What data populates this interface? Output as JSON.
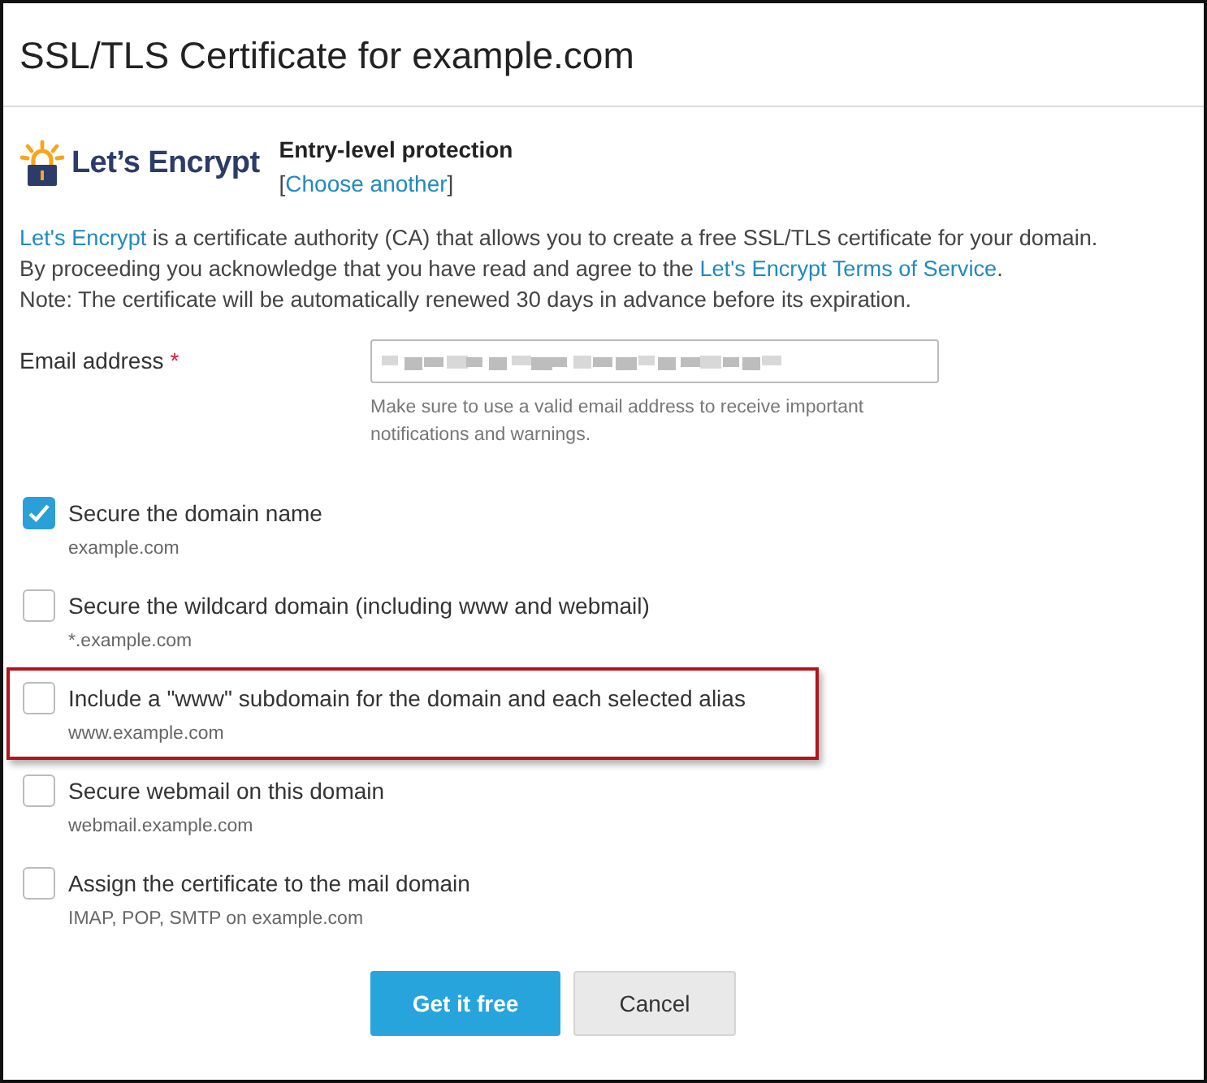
{
  "title": "SSL/TLS Certificate for example.com",
  "provider": {
    "logo_text": "Let’s Encrypt",
    "name": "Entry-level protection",
    "bracket_open": "[",
    "link": "Choose another",
    "bracket_close": "]"
  },
  "paragraph": [
    [
      {
        "kind": "link",
        "text": "Let's Encrypt"
      },
      {
        "kind": "text",
        "text": " is a certificate authority (CA) that allows you to create a free SSL/TLS certificate for your domain."
      }
    ],
    [
      {
        "kind": "text",
        "text": "By proceeding you acknowledge that you have read and agree to the "
      },
      {
        "kind": "link",
        "text": "Let's Encrypt Terms of Service"
      },
      {
        "kind": "text",
        "text": "."
      }
    ],
    [
      {
        "kind": "text",
        "text": "Note: The certificate will be automatically renewed 30 days in advance before its expiration."
      }
    ]
  ],
  "email": {
    "label": "Email address",
    "required_mark": "*",
    "hint": "Make sure to use a valid email address to receive important notifications and warnings."
  },
  "options": [
    {
      "label": "Secure the domain name",
      "sublabel": "example.com",
      "checked": true,
      "highlighted": false
    },
    {
      "label": "Secure the wildcard domain (including www and webmail)",
      "sublabel": "*.example.com",
      "checked": false,
      "highlighted": false
    },
    {
      "label": "Include a \"www\" subdomain for the domain and each selected alias",
      "sublabel": "www.example.com",
      "checked": false,
      "highlighted": true
    },
    {
      "label": "Secure webmail on this domain",
      "sublabel": "webmail.example.com",
      "checked": false,
      "highlighted": false
    },
    {
      "label": "Assign the certificate to the mail domain",
      "sublabel": "IMAP, POP, SMTP on example.com",
      "checked": false,
      "highlighted": false
    }
  ],
  "buttons": [
    {
      "label": "Get it free",
      "kind": "primary"
    },
    {
      "label": "Cancel",
      "kind": "secondary"
    }
  ]
}
